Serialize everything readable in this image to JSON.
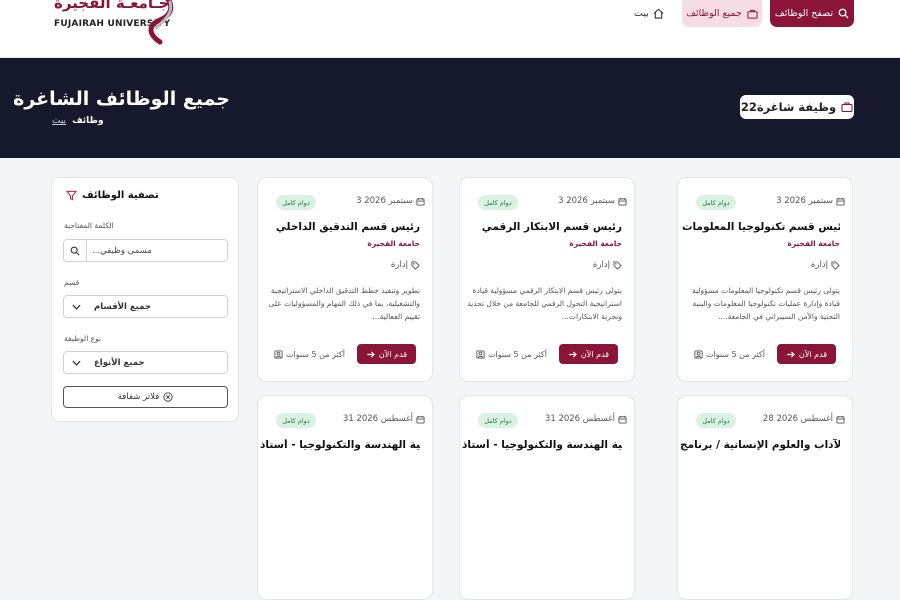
{
  "header": {
    "logo_ar": "جـامعـة الفجيرة",
    "logo_en": "FUJAIRAH UNIVERSITY",
    "nav": {
      "browse_label": "تصفح الوظائف",
      "all_label": "جميع الوظائف",
      "home_label": "بيت"
    }
  },
  "hero": {
    "title": "جميع الوظائف الشاغرة",
    "breadcrumb": {
      "home": "بيت",
      "current": "وظائف"
    },
    "open_count": "وظيفة شاغرة22"
  },
  "sidebar": {
    "title": "تصفية الوظائف",
    "keyword_label": "الكلمة المفتاحية",
    "keyword_placeholder": "...مسمى وظيفي",
    "dept_label": "قسم",
    "dept_value": "جميع الأقسام",
    "type_label": "نوع الوظيفة",
    "type_value": "جميع الأنواع",
    "clear_label": "فلاتر شفافة"
  },
  "jobs": [
    {
      "date": "3 سبتمبر 2026",
      "badge": "دوام كامل",
      "title": "رئيس قسم تكنولوجيا المعلومات",
      "org": "جامعة الفجيرة",
      "tag": "إدارة",
      "desc": "يتولى رئيس قسم تكنولوجيا المعلومات مسؤولية قيادة وإدارة عمليات تكنولوجيا المعلومات والبنية التحتية والأمن السيبراني في الجامعة....",
      "experience": "أكثر من 5 سنوات",
      "apply": "قدم الآن"
    },
    {
      "date": "3 سبتمبر 2026",
      "badge": "دوام كامل",
      "title": "رئيس قسم الابتكار الرقمي",
      "org": "جامعة الفجيرة",
      "tag": "إدارة",
      "desc": "يتولى رئيس قسم الابتكار الرقمي مسؤولية قيادة استراتيجية التحول الرقمي للجامعة من خلال تحديد وتجربة الابتكارات...",
      "experience": "أكثر من 5 سنوات",
      "apply": "قدم الآن"
    },
    {
      "date": "3 سبتمبر 2026",
      "badge": "دوام كامل",
      "title": "رئيس قسم التدقيق الداخلي",
      "org": "جامعة الفجيرة",
      "tag": "إدارة",
      "desc": "تطوير وتنفيذ خطط التدقيق الداخلي الاستراتيجية والتشغيلية، بما في ذلك المهام والمسؤوليات على تقييم الفعالية...",
      "experience": "أكثر من 5 سنوات",
      "apply": "قدم الآن"
    },
    {
      "date": "28 أغسطس 2026",
      "badge": "دوام كامل",
      "title": "كلية الآداب والعلوم الإنسانية / برنامج",
      "org": "",
      "tag": "",
      "desc": "",
      "experience": "",
      "apply": ""
    },
    {
      "date": "31 أغسطس 2026",
      "badge": "دوام كامل",
      "title": "كلية الهندسة والتكنولوجيا - أستاذ",
      "org": "",
      "tag": "",
      "desc": "",
      "experience": "",
      "apply": ""
    },
    {
      "date": "31 أغسطس 2026",
      "badge": "دوام كامل",
      "title": "كلية الهندسة والتكنولوجيا - أستاذ",
      "org": "",
      "tag": "",
      "desc": "",
      "experience": "",
      "apply": ""
    }
  ]
}
